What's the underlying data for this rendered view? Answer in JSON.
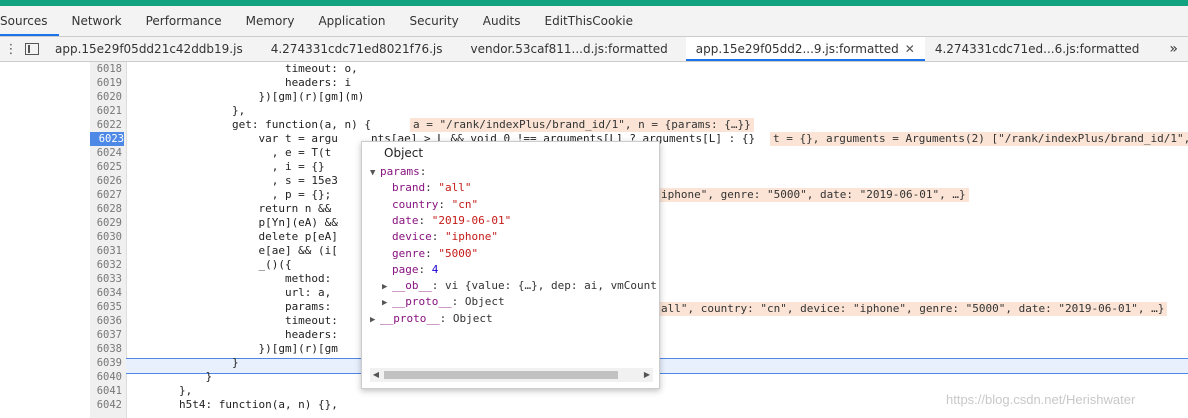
{
  "devtools_tabs": [
    "Sources",
    "Network",
    "Performance",
    "Memory",
    "Application",
    "Security",
    "Audits",
    "EditThisCookie"
  ],
  "file_tabs": [
    {
      "label": "app.15e29f05dd21c42ddb19.js"
    },
    {
      "label": "4.274331cdc71ed8021f76.js"
    },
    {
      "label": "vendor.53caf811...d.js:formatted"
    },
    {
      "label": "app.15e29f05dd2...9.js:formatted",
      "close": "✕"
    },
    {
      "label": "4.274331cdc71ed...6.js:formatted"
    }
  ],
  "more_tabs": "»",
  "kebab": "⋮",
  "line_numbers": [
    "6018",
    "6019",
    "6020",
    "6021",
    "6022",
    "6023",
    "6024",
    "6025",
    "6026",
    "6027",
    "6028",
    "6029",
    "6030",
    "6031",
    "6032",
    "6033",
    "6034",
    "6035",
    "6036",
    "6037",
    "6038",
    "6039",
    "6040",
    "6041",
    "6042"
  ],
  "code_lines": [
    "                        timeout: o,",
    "                        headers: i",
    "                    })[gm](r)[gm](m)",
    "                },",
    "                get: function(a, n) {",
    "                    var t = argu     nts[ae] > L && void 0 !== arguments[L] ? arguments[L] : {}",
    "                      , e = T(t",
    "                      , i = {}",
    "                      , s = 15e3",
    "                      , p = {};",
    "                    return n &&",
    "                    p[Yn](eA) &&",
    "                    delete p[eA]",
    "                    e[ae] && (i[",
    "                    _()({",
    "                        method:",
    "                        url: a,",
    "                        params:",
    "                        timeout:",
    "                        headers:",
    "                    })[gm](r)[gm",
    "                }",
    "            }",
    "        },",
    "        h5t4: function(a, n) {},"
  ],
  "inline_values": {
    "l6022": "a = \"/rank/indexPlus/brand_id/1\", n = {params: {…}}",
    "l6023": "t = {}, arguments = Arguments(2) [\"/rank/indexPlus/brand_id/1\",",
    "l6027": "iphone\", genre: \"5000\", date: \"2019-06-01\", …}",
    "l6035": "all\", country: \"cn\", device: \"iphone\", genre: \"5000\", date: \"2019-06-01\", …}"
  },
  "popup": {
    "title": "Object",
    "rows": [
      {
        "indent": 0,
        "tri": "▼",
        "key": "params",
        "sep": ":",
        "val": "",
        "type": "obj"
      },
      {
        "indent": 1,
        "tri": "",
        "key": "brand",
        "sep": ": ",
        "val": "\"all\"",
        "type": "str"
      },
      {
        "indent": 1,
        "tri": "",
        "key": "country",
        "sep": ": ",
        "val": "\"cn\"",
        "type": "str"
      },
      {
        "indent": 1,
        "tri": "",
        "key": "date",
        "sep": ": ",
        "val": "\"2019-06-01\"",
        "type": "str"
      },
      {
        "indent": 1,
        "tri": "",
        "key": "device",
        "sep": ": ",
        "val": "\"iphone\"",
        "type": "str"
      },
      {
        "indent": 1,
        "tri": "",
        "key": "genre",
        "sep": ": ",
        "val": "\"5000\"",
        "type": "str"
      },
      {
        "indent": 1,
        "tri": "",
        "key": "page",
        "sep": ": ",
        "val": "4",
        "type": "num"
      },
      {
        "indent": 1,
        "tri": "▶",
        "key": "__ob__",
        "sep": ": ",
        "val": "vi {value: {…}, dep: ai, vmCount",
        "type": "obj"
      },
      {
        "indent": 1,
        "tri": "▶",
        "key": "__proto__",
        "sep": ": ",
        "val": "Object",
        "type": "obj"
      },
      {
        "indent": 0,
        "tri": "▶",
        "key": "__proto__",
        "sep": ": ",
        "val": "Object",
        "type": "obj"
      }
    ]
  },
  "watermark": "https://blog.csdn.net/Herishwater",
  "colors": {
    "accent": "#1a73e8",
    "breakpoint": "#4d88e6",
    "inline_bg": "#fbe4d5"
  }
}
